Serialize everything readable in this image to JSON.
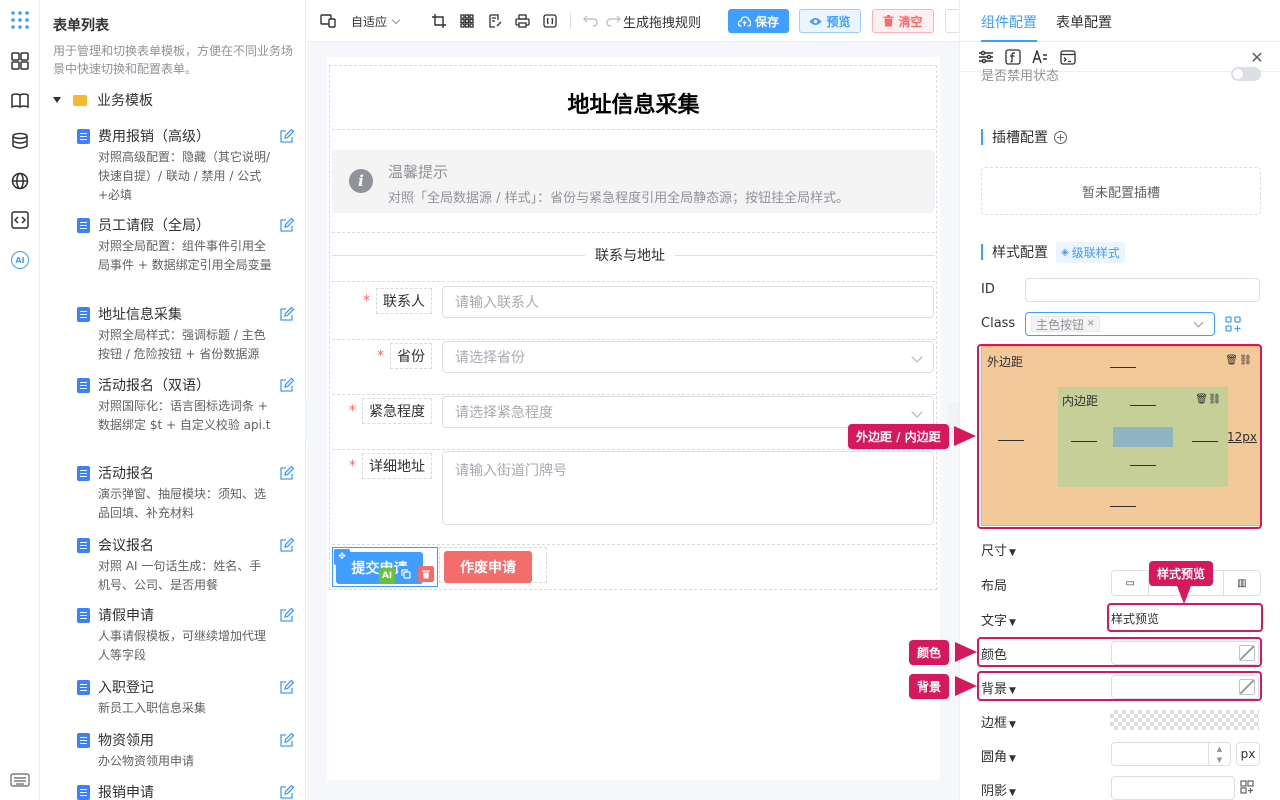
{
  "colors": {
    "primary": "#409eff",
    "danger": "#f56c6c",
    "highlight": "#d6195c",
    "margin_box": "#f2c998",
    "padding_box": "#c5cf97"
  },
  "rail": {
    "icons": [
      "apps-grid-icon",
      "components-icon",
      "book-icon",
      "database-icon",
      "globe-icon",
      "code-icon",
      "ai-icon",
      "keyboard-icon"
    ],
    "ai_label": "AI"
  },
  "left": {
    "title": "表单列表",
    "description": "用于管理和切换表单模板，方便在不同业务场景中快速切换和配置表单。",
    "folder": "业务模板",
    "templates": [
      {
        "name": "费用报销（高级）",
        "desc": "对照高级配置：隐藏（其它说明/快速自提）/ 联动 / 禁用 / 公式+必填"
      },
      {
        "name": "员工请假（全局）",
        "desc": "对照全局配置：组件事件引用全局事件 + 数据绑定引用全局变量"
      },
      {
        "name": "地址信息采集",
        "desc": "对照全局样式：强调标题 / 主色按钮 / 危险按钮 + 省份数据源"
      },
      {
        "name": "活动报名（双语）",
        "desc": "对照国际化：语言图标选词条 + 数据绑定 $t + 自定义校验 api.t"
      },
      {
        "name": "活动报名",
        "desc": "演示弹窗、抽屉模块：须知、选品回填、补充材料"
      },
      {
        "name": "会议报名",
        "desc": "对照 AI 一句话生成：姓名、手机号、公司、是否用餐"
      },
      {
        "name": "请假申请",
        "desc": "人事请假模板，可继续增加代理人等字段"
      },
      {
        "name": "入职登记",
        "desc": "新员工入职信息采集"
      },
      {
        "name": "物资领用",
        "desc": "办公物资领用申请"
      },
      {
        "name": "报销申请",
        "desc": ""
      }
    ]
  },
  "toolbar": {
    "adaptive": "自适应",
    "gen_rules": "生成拖拽规则",
    "save": "保存",
    "preview": "预览",
    "clear": "清空"
  },
  "form": {
    "title": "地址信息采集",
    "alert_title": "温馨提示",
    "alert_desc": "对照「全局数据源 / 样式」：省份与紧急程度引用全局静态源；按钮挂全局样式。",
    "divider": "联系与地址",
    "fields": [
      {
        "label": "联系人",
        "placeholder": "请输入联系人"
      },
      {
        "label": "省份",
        "placeholder": "请选择省份"
      },
      {
        "label": "紧急程度",
        "placeholder": "请选择紧急程度"
      },
      {
        "label": "详细地址",
        "placeholder": "请输入街道门牌号"
      }
    ],
    "submit": "提交申请",
    "cancel": "作废申请",
    "ai_badge": "AI"
  },
  "right": {
    "tab_component": "组件配置",
    "tab_form": "表单配置",
    "disabled_status": "是否禁用状态",
    "slot_title": "插槽配置",
    "slot_empty": "暂未配置插槽",
    "style_title": "样式配置",
    "cascade": "级联样式",
    "id_label": "ID",
    "class_label": "Class",
    "class_tag": "主色按钮",
    "margin_label": "外边距",
    "padding_label": "内边距",
    "margin_right_value": "12px",
    "size_label": "尺寸",
    "layout_label": "布局",
    "text_label": "文字",
    "text_value": "样式预览",
    "color_label": "颜色",
    "bg_label": "背景",
    "border_label": "边框",
    "radius_label": "圆角",
    "radius_unit": "px",
    "shadow_label": "阴影"
  },
  "callouts": {
    "margin_padding": "外边距 / 内边距",
    "style_preview": "样式预览",
    "color": "颜色",
    "background": "背景"
  }
}
